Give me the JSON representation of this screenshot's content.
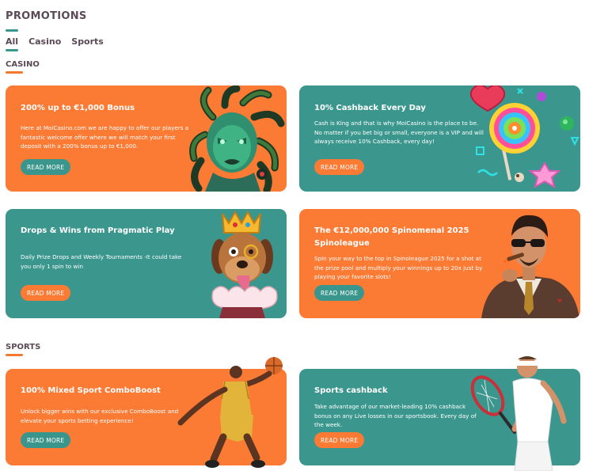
{
  "page": {
    "title": "PROMOTIONS"
  },
  "tabs": [
    {
      "label": "All",
      "active": true
    },
    {
      "label": "Casino",
      "active": false
    },
    {
      "label": "Sports",
      "active": false
    }
  ],
  "sections": {
    "casino": {
      "title": "CASINO"
    },
    "sports": {
      "title": "SPORTS"
    }
  },
  "cards": [
    {
      "title": "200% up to €1,000 Bonus",
      "text": "Here at MoiCasino.com we are happy to offer our players a fantastic welcome offer where we will match your first deposit with a 200% bonus up to €1,000.",
      "button": "READ MORE",
      "art": "medusa-image"
    },
    {
      "title": "10% Cashback Every Day",
      "text": "Cash is King and that is why MoiCasino is the place to be. No matter if you bet big or small, everyone is a VIP and will always receive 10% Cashback, every day!",
      "button": "READ MORE",
      "art": "lollipop-candy-image"
    },
    {
      "title": "Drops & Wins from Pragmatic Play",
      "text": "Daily Prize Drops and Weekly Tournaments -It could take you only 1 spin to win",
      "button": "READ MORE",
      "art": "crowned-dog-image"
    },
    {
      "title": "The €12,000,000 Spinomenal 2025 Spinoleague",
      "text": "Spin your way to the top in Spinoleague 2025 for a shot at the prize pool and multiply your winnings up to 20x just by playing your favorite slots!",
      "button": "READ MORE",
      "art": "mobster-cigar-image"
    },
    {
      "title": "100% Mixed Sport ComboBoost",
      "text": "Unlock bigger wins with our exclusive ComboBoost and elevate your sports betting experience!",
      "button": "READ MORE",
      "art": "basketball-player-image"
    },
    {
      "title": "Sports cashback",
      "text": "Take advantage of our market-leading 10% cashback bonus on any Live losses in our sportsbook. Every day of the week.",
      "button": "READ MORE",
      "art": "tennis-player-image"
    }
  ],
  "colors": {
    "orange": "#fb7a34",
    "teal": "#3b978e",
    "heading": "#5a4a55"
  }
}
